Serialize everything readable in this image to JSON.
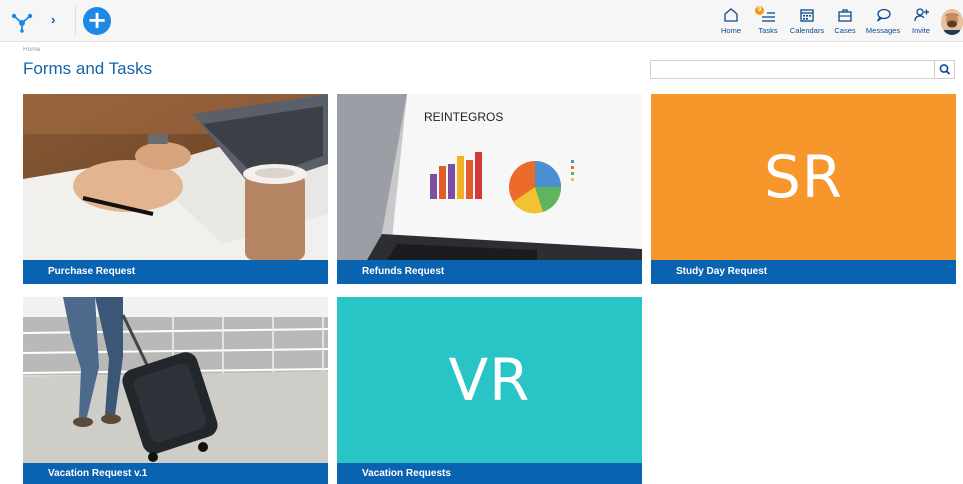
{
  "header": {
    "nav": [
      {
        "id": "home",
        "label": "Home",
        "icon": "home-icon"
      },
      {
        "id": "tasks",
        "label": "Tasks",
        "icon": "tasks-icon",
        "badge": "9"
      },
      {
        "id": "calendars",
        "label": "Calendars",
        "icon": "calendar-icon"
      },
      {
        "id": "cases",
        "label": "Cases",
        "icon": "briefcase-icon"
      },
      {
        "id": "messages",
        "label": "Messages",
        "icon": "chat-icon"
      },
      {
        "id": "invite",
        "label": "Invite",
        "icon": "add-user-icon"
      }
    ]
  },
  "breadcrumb": "Home",
  "page_title": "Forms and Tasks",
  "search": {
    "placeholder": "",
    "value": ""
  },
  "cards": [
    {
      "title": "Purchase Request",
      "image": "photo-writing-with-coffee"
    },
    {
      "title": "Refunds Request",
      "image": "photo-laptop-charts",
      "image_text": "REINTEGROS"
    },
    {
      "title": "Study Day Request",
      "initials": "SR",
      "color": "#f7962b"
    },
    {
      "title": "Vacation Request v.1",
      "image": "photo-traveler-suitcase"
    },
    {
      "title": "Vacation Requests",
      "initials": "VR",
      "color": "#29c4c6"
    }
  ],
  "colors": {
    "accent": "#1565a8",
    "card_footer": "#0a63b1",
    "add_button": "#1e88e5"
  }
}
